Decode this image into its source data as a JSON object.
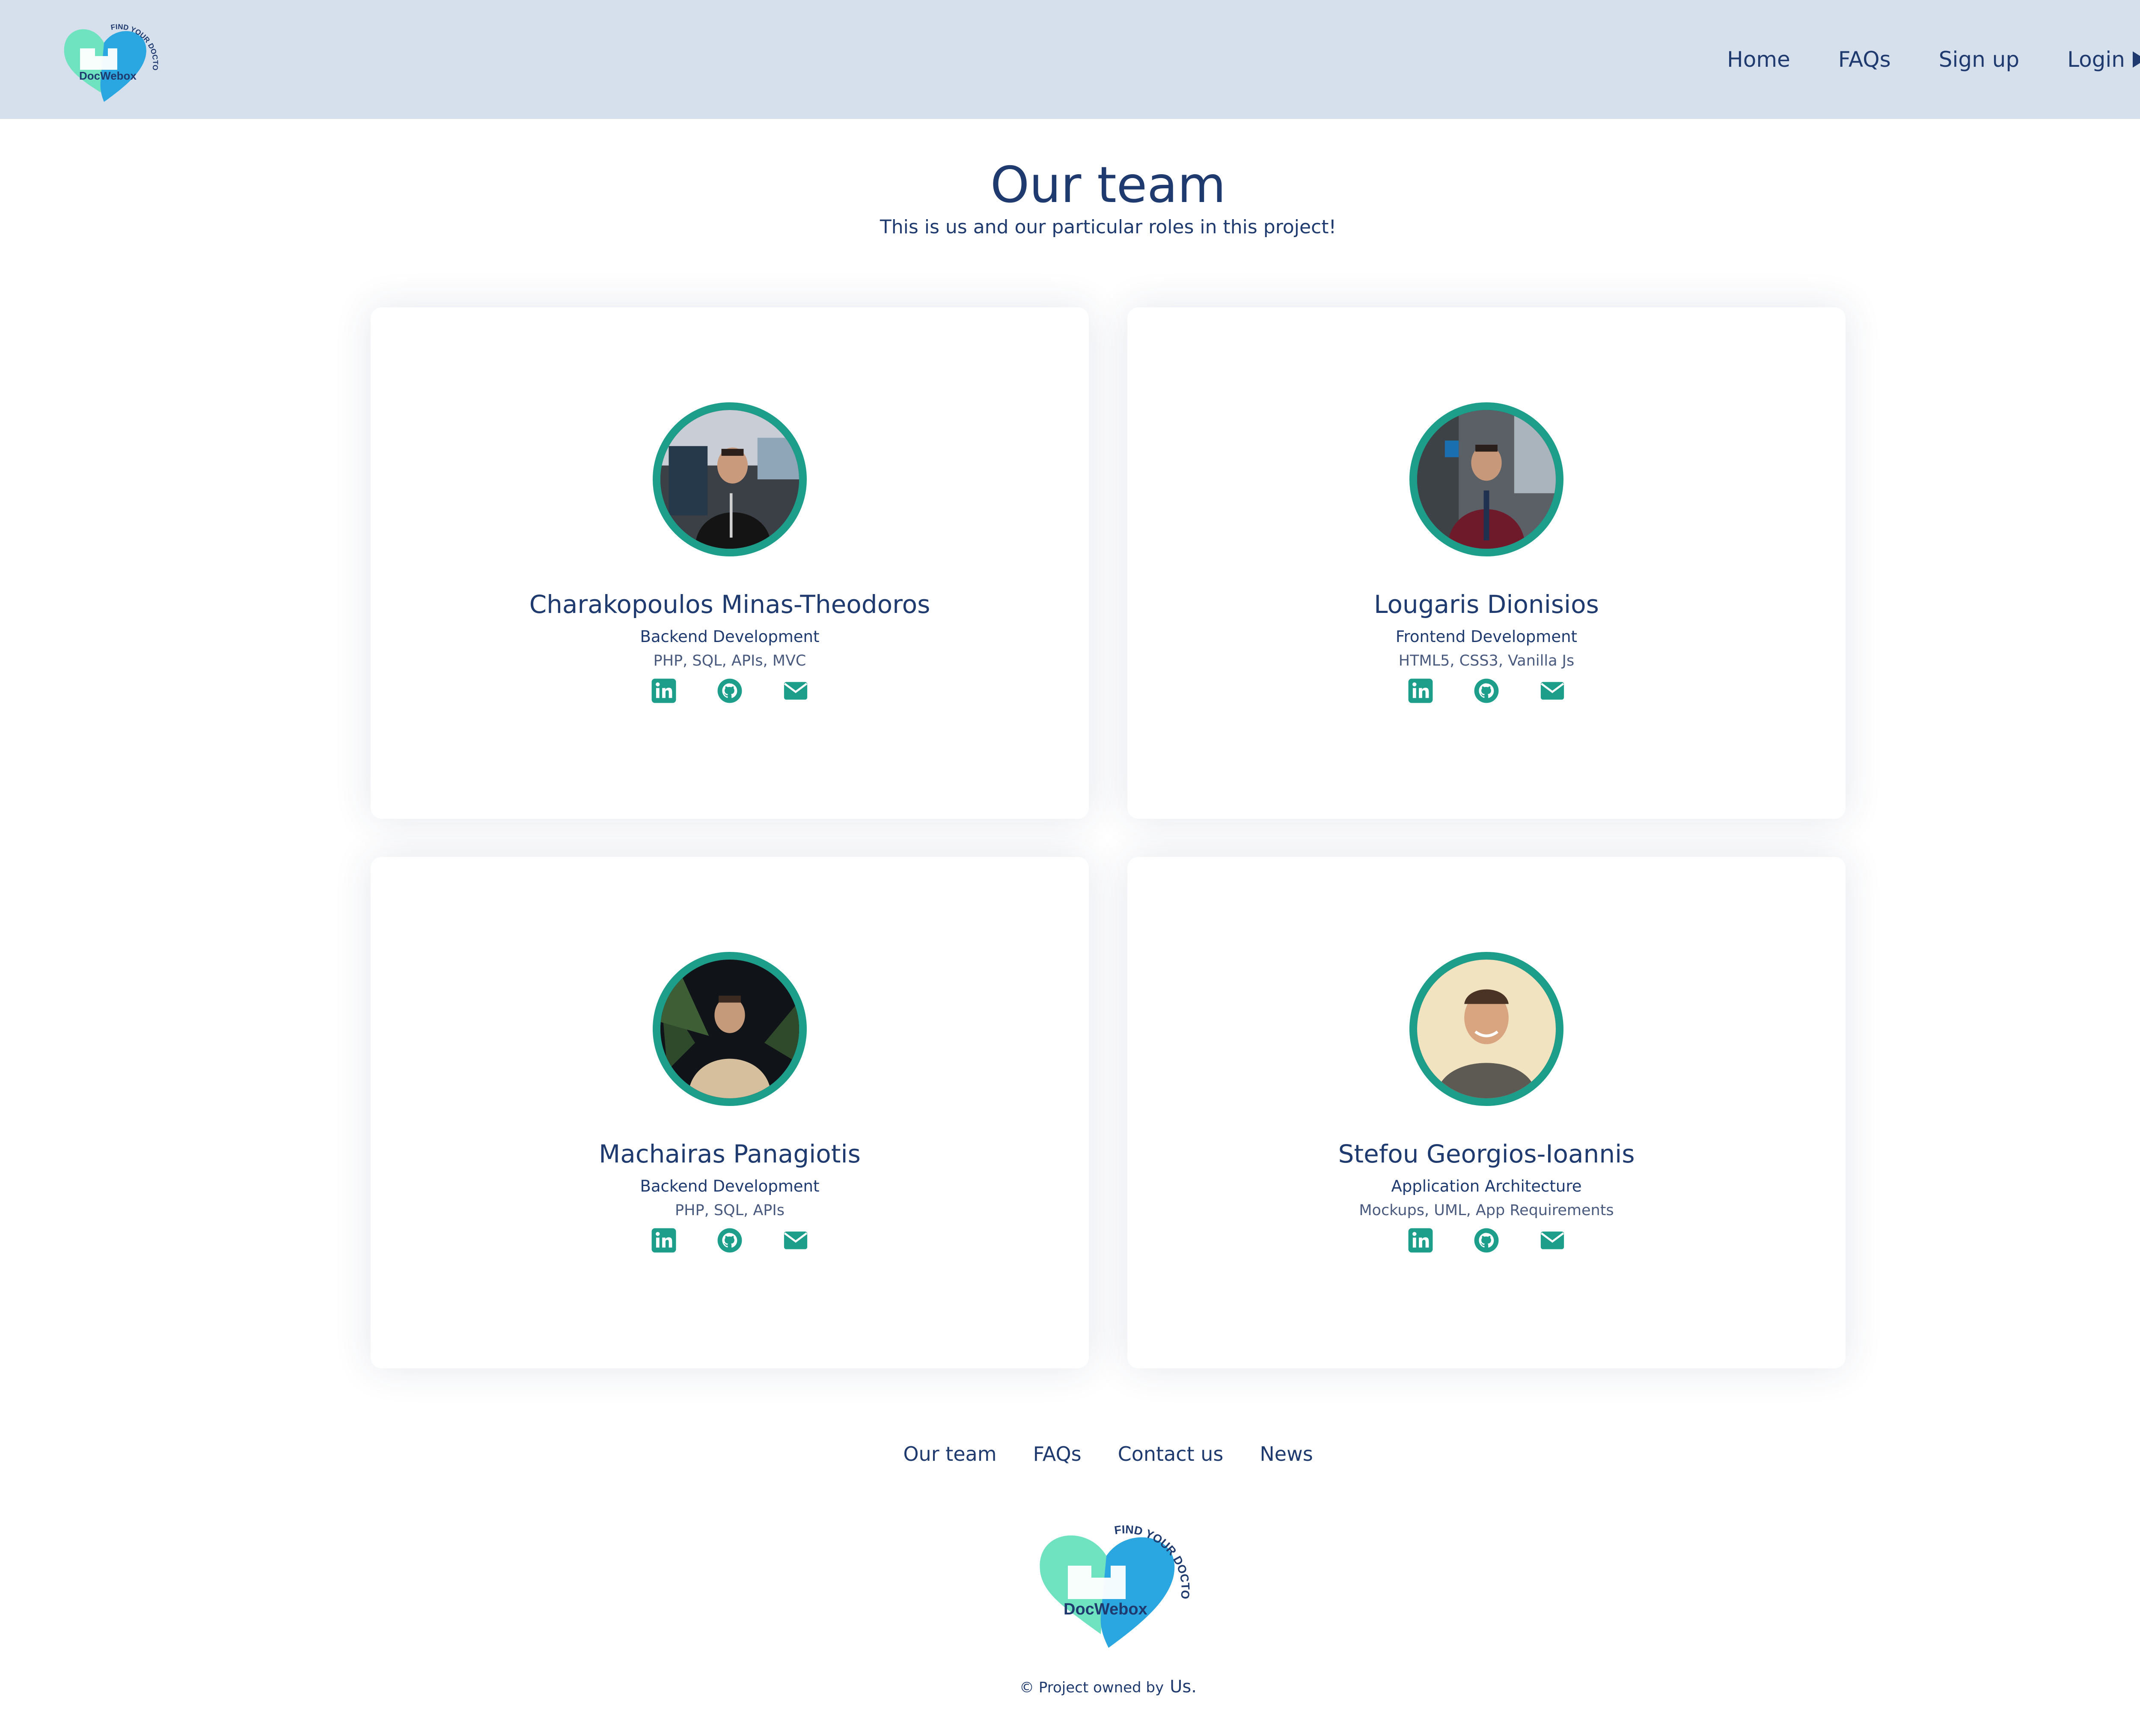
{
  "brand": {
    "name": "DocWebox",
    "tagline": "FIND YOUR DOCTOR"
  },
  "nav": {
    "home": "Home",
    "faqs": "FAQs",
    "signup": "Sign up",
    "login": "Login"
  },
  "page": {
    "title": "Our team",
    "subtitle": "This is us and our particular roles in this project!"
  },
  "team": [
    {
      "name": "Charakopoulos Minas-Theodoros",
      "role": "Backend Development",
      "skills": "PHP, SQL, APIs, MVC"
    },
    {
      "name": "Lougaris Dionisios",
      "role": "Frontend Development",
      "skills": "HTML5, CSS3, Vanilla Js"
    },
    {
      "name": "Machairas Panagiotis",
      "role": "Backend Development",
      "skills": "PHP, SQL, APIs"
    },
    {
      "name": "Stefou Georgios-Ioannis",
      "role": "Application Architecture",
      "skills": "Mockups, UML, App Requirements"
    }
  ],
  "social_icons": [
    "linkedin-icon",
    "github-icon",
    "email-icon"
  ],
  "footer": {
    "links": [
      "Our team",
      "FAQs",
      "Contact us",
      "News"
    ],
    "copyright": "© Project owned by",
    "owner": "Us."
  },
  "colors": {
    "header_bg": "#d6dfec",
    "primary_text": "#1f3a6e",
    "accent": "#1d9e8b",
    "logo_mint": "#6fe3c0",
    "logo_blue": "#2aa6e0"
  }
}
